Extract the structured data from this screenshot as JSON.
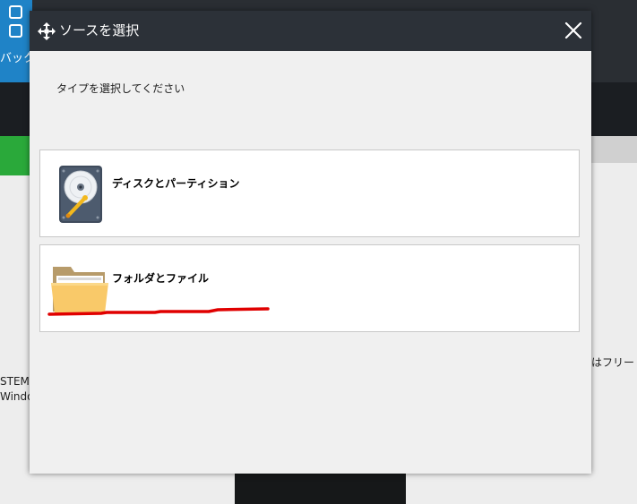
{
  "background": {
    "top_label": "バック",
    "left_texts": [
      "STEM",
      "Window"
    ],
    "right_text": "はフリー"
  },
  "dialog": {
    "title": "ソースを選択",
    "subtitle": "タイプを選択してください",
    "options": [
      {
        "label": "ディスクとパーティション",
        "icon": "hard-disk-icon"
      },
      {
        "label": "フォルダとファイル",
        "icon": "folder-icon"
      }
    ],
    "close_icon": "close-icon"
  },
  "colors": {
    "titlebar": "#2c3138",
    "dialog_bg": "#f0f0f0",
    "option_bg": "#ffffff",
    "annotation_red": "#e00000",
    "folder": "#f9c969"
  }
}
